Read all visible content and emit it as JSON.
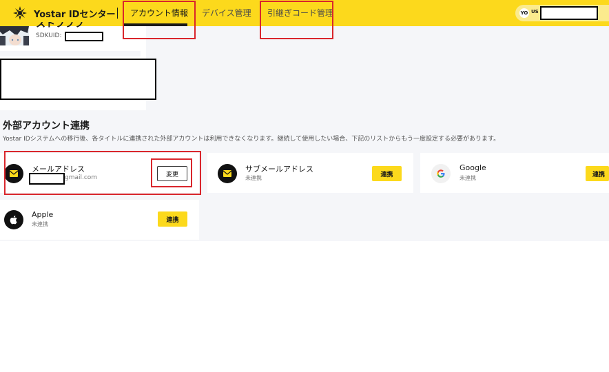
{
  "header": {
    "app_title": "Yostar IDセンター",
    "tabs": [
      {
        "label": "アカウント情報",
        "active": true
      },
      {
        "label": "デバイス管理",
        "active": false
      },
      {
        "label": "引継ぎコード管理",
        "active": false
      }
    ],
    "lang": {
      "current": "YO",
      "option": "US"
    }
  },
  "profile": {
    "username": "ストフフフ",
    "sdkuid_label": "SDKUID: "
  },
  "section": {
    "title": "外部アカウント連携",
    "description": "Yostar IDシステムへの移行後、各タイトルに連携された外部アカウントは利用できなくなります。継続して使用したい場合、下記のリストからもう一度設定する必要があります。"
  },
  "accounts": [
    {
      "name": "メールアドレス",
      "status_suffix": "gmail.com",
      "button": "変更"
    },
    {
      "name": "サブメールアドレス",
      "status": "未連携",
      "button": "連携"
    },
    {
      "name": "Google",
      "status": "未連携",
      "button": "連携"
    },
    {
      "name": "Apple",
      "status": "未連携",
      "button": "連携"
    }
  ],
  "colors": {
    "brand_yellow": "#fcd91c",
    "background_gray": "#f5f6f9",
    "annotation_red": "#d9262c"
  }
}
